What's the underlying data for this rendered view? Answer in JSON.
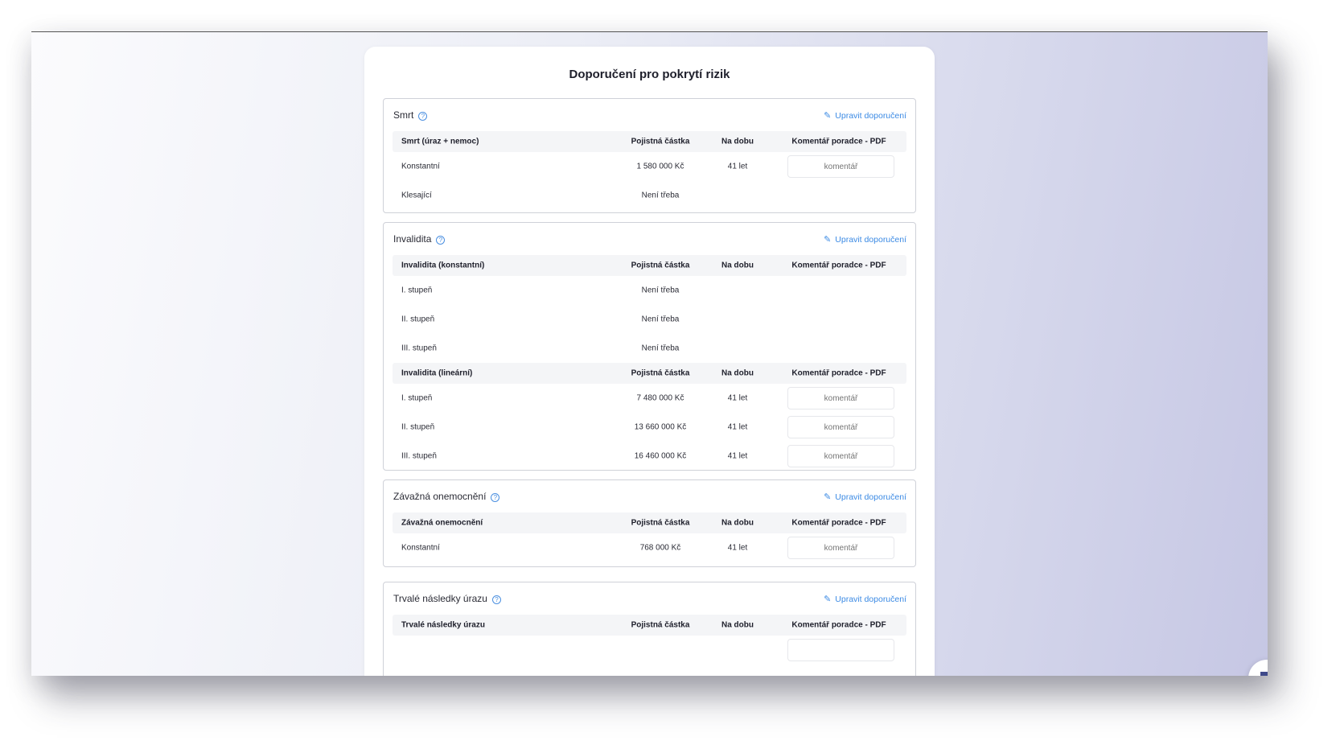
{
  "page": {
    "title": "Doporučení pro pokrytí rizik",
    "edit_label": "Upravit doporučení",
    "comment_placeholder": "komentář"
  },
  "sections": [
    {
      "title": "Smrt",
      "tables": [
        {
          "headers": [
            "Smrt (úraz + nemoc)",
            "Pojistná částka",
            "Na dobu",
            "Komentář poradce - PDF"
          ],
          "rows": [
            {
              "label": "Konstantní",
              "amount": "1 580 000 Kč",
              "period": "41 let",
              "has_comment": true
            },
            {
              "label": "Klesající",
              "amount": "Není třeba",
              "period": "",
              "has_comment": false
            }
          ]
        }
      ]
    },
    {
      "title": "Invalidita",
      "tables": [
        {
          "headers": [
            "Invalidita (konstantní)",
            "Pojistná částka",
            "Na dobu",
            "Komentář poradce - PDF"
          ],
          "rows": [
            {
              "label": "I. stupeň",
              "amount": "Není třeba",
              "period": "",
              "has_comment": false
            },
            {
              "label": "II. stupeň",
              "amount": "Není třeba",
              "period": "",
              "has_comment": false
            },
            {
              "label": "III. stupeň",
              "amount": "Není třeba",
              "period": "",
              "has_comment": false
            }
          ]
        },
        {
          "headers": [
            "Invalidita (lineární)",
            "Pojistná částka",
            "Na dobu",
            "Komentář poradce - PDF"
          ],
          "rows": [
            {
              "label": "I. stupeň",
              "amount": "7 480 000 Kč",
              "period": "41 let",
              "has_comment": true
            },
            {
              "label": "II. stupeň",
              "amount": "13 660 000 Kč",
              "period": "41 let",
              "has_comment": true
            },
            {
              "label": "III. stupeň",
              "amount": "16 460 000 Kč",
              "period": "41 let",
              "has_comment": true
            }
          ]
        }
      ]
    },
    {
      "title": "Závažná onemocnění",
      "tables": [
        {
          "headers": [
            "Závažná onemocnění",
            "Pojistná částka",
            "Na dobu",
            "Komentář poradce - PDF"
          ],
          "rows": [
            {
              "label": "Konstantní",
              "amount": "768 000 Kč",
              "period": "41 let",
              "has_comment": true
            }
          ]
        }
      ]
    },
    {
      "title": "Trvalé následky úrazu",
      "tables": [
        {
          "headers": [
            "Trvalé následky úrazu",
            "Pojistná částka",
            "Na dobu",
            "Komentář poradce - PDF"
          ],
          "rows": []
        }
      ]
    }
  ],
  "colors": {
    "accent": "#3b8ae4",
    "chat_icon": "#3f4a8a",
    "border": "#cfd1d8",
    "header_bg": "#f4f5f7"
  },
  "icons": {
    "help": "question-circle-icon",
    "edit": "pencil-icon",
    "chat": "chat-bubble-icon"
  }
}
